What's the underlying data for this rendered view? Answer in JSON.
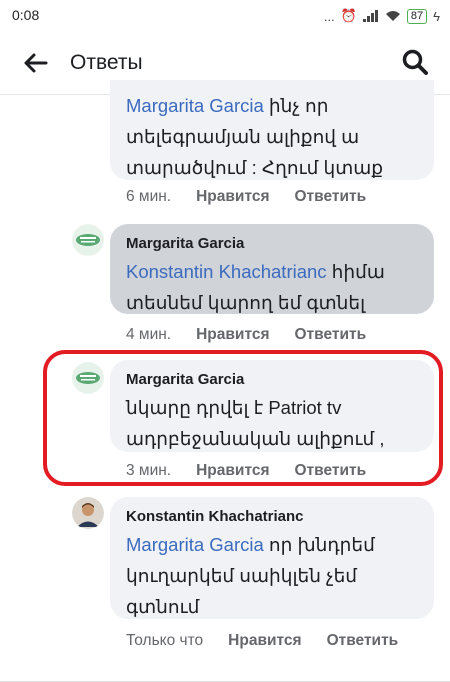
{
  "status_bar": {
    "time": "0:08",
    "dots": "...",
    "battery": "87"
  },
  "header": {
    "title": "Ответы"
  },
  "comments": [
    {
      "author": "",
      "mention": "Margarita Garcia",
      "text_line1": " ինչ որ",
      "text_line2": "տելեգրամյան  ալիքով ա",
      "text_line3": "տարածվում : Հղում կտաք",
      "time": "6 мин.",
      "like": "Нравится",
      "reply": "Ответить"
    },
    {
      "author": "Margarita Garcia",
      "mention": "Konstantin Khachatrianc",
      "text_line1": "  հիմա",
      "text_line2": "տեսնեմ կարող  եմ գտնել",
      "time": "4 мин.",
      "like": "Нравится",
      "reply": "Ответить"
    },
    {
      "author": "Margarita Garcia",
      "text_line1": "նկարը դրվել է Patriot tv",
      "text_line2": "ադրբեջանական ալիքում ,",
      "time": "3 мин.",
      "like": "Нравится",
      "reply": "Ответить"
    },
    {
      "author": "Konstantin Khachatrianc",
      "mention": "Margarita Garcia",
      "text_line1": " որ խնդրեմ",
      "text_line2": "կուղարկեմ սաիկլեն չեմ",
      "text_line3": "գտնում",
      "time": "Только что",
      "like": "Нравится",
      "reply": "Ответить"
    }
  ],
  "colors": {
    "mention": "#3b6bbf",
    "highlight": "#e31b23",
    "bubble": "#f0f2f5",
    "bubble_selected": "#d0d3d8"
  }
}
